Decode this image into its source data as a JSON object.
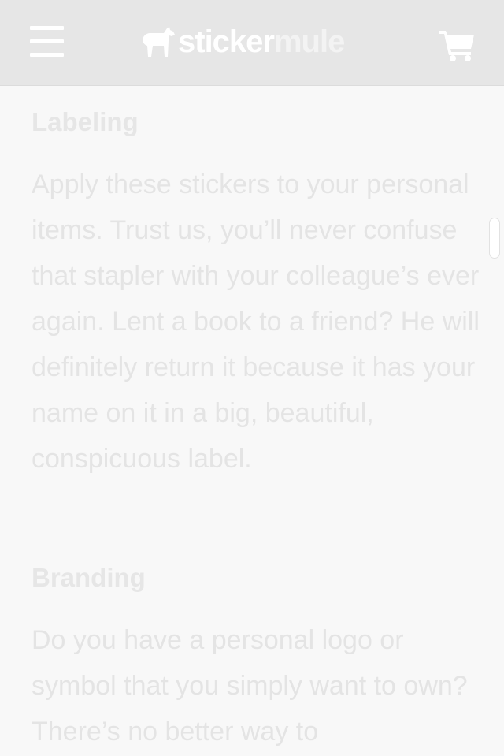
{
  "header": {
    "brand_part1": "sticker",
    "brand_part2": "mule",
    "icons": {
      "menu": "hamburger-menu-icon",
      "logo": "mule-logo-icon",
      "cart": "shopping-cart-icon"
    }
  },
  "sections": [
    {
      "heading": "Labeling",
      "body": "Apply these stickers to your personal items. Trust us, you’ll never confuse that stapler with your colleague’s ever again. Lent a book to a friend? He will definitely return it because it has your name on it in a big, beautiful, conspicuous label."
    },
    {
      "heading": "Branding",
      "body": "Do you have a personal logo or symbol that you simply want to own? There’s no better way to"
    }
  ],
  "colors": {
    "header_bg": "#e6e6e6",
    "page_bg": "#f8f8f8",
    "text": "#e4e4e4"
  }
}
